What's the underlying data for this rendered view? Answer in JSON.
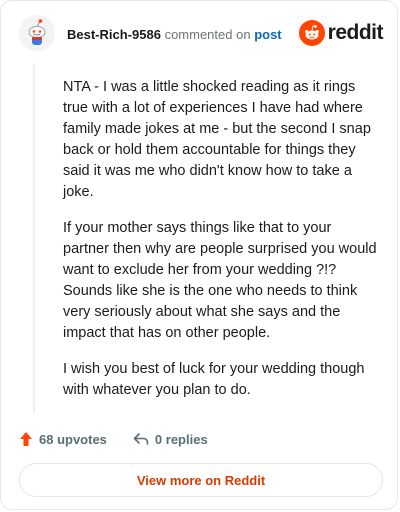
{
  "header": {
    "username": "Best-Rich-9586",
    "commented_text": "commented on",
    "post_link": "post",
    "brand_name": "reddit",
    "brand_color": "#ff4500"
  },
  "comment": {
    "paragraphs": [
      "NTA - I was a little shocked reading as it rings true with a lot of experiences I have had where family made jokes at me - but the second I snap back or hold them accountable for things they said it was me who didn't know how to take a joke.",
      "If your mother says things like that to your partner then why are people surprised you would want to exclude her from your wedding ?!? Sounds like she is the one who needs to think very seriously about what she says and the impact that has on other people.",
      "I wish you best of luck for your wedding though with whatever you plan to do."
    ]
  },
  "footer": {
    "upvotes": "68 upvotes",
    "replies": "0 replies",
    "upvote_icon": "upvote-arrow-icon",
    "reply_icon": "reply-arrow-icon",
    "upvote_color": "#ff4500"
  },
  "view_button": {
    "label": "View more on Reddit"
  }
}
